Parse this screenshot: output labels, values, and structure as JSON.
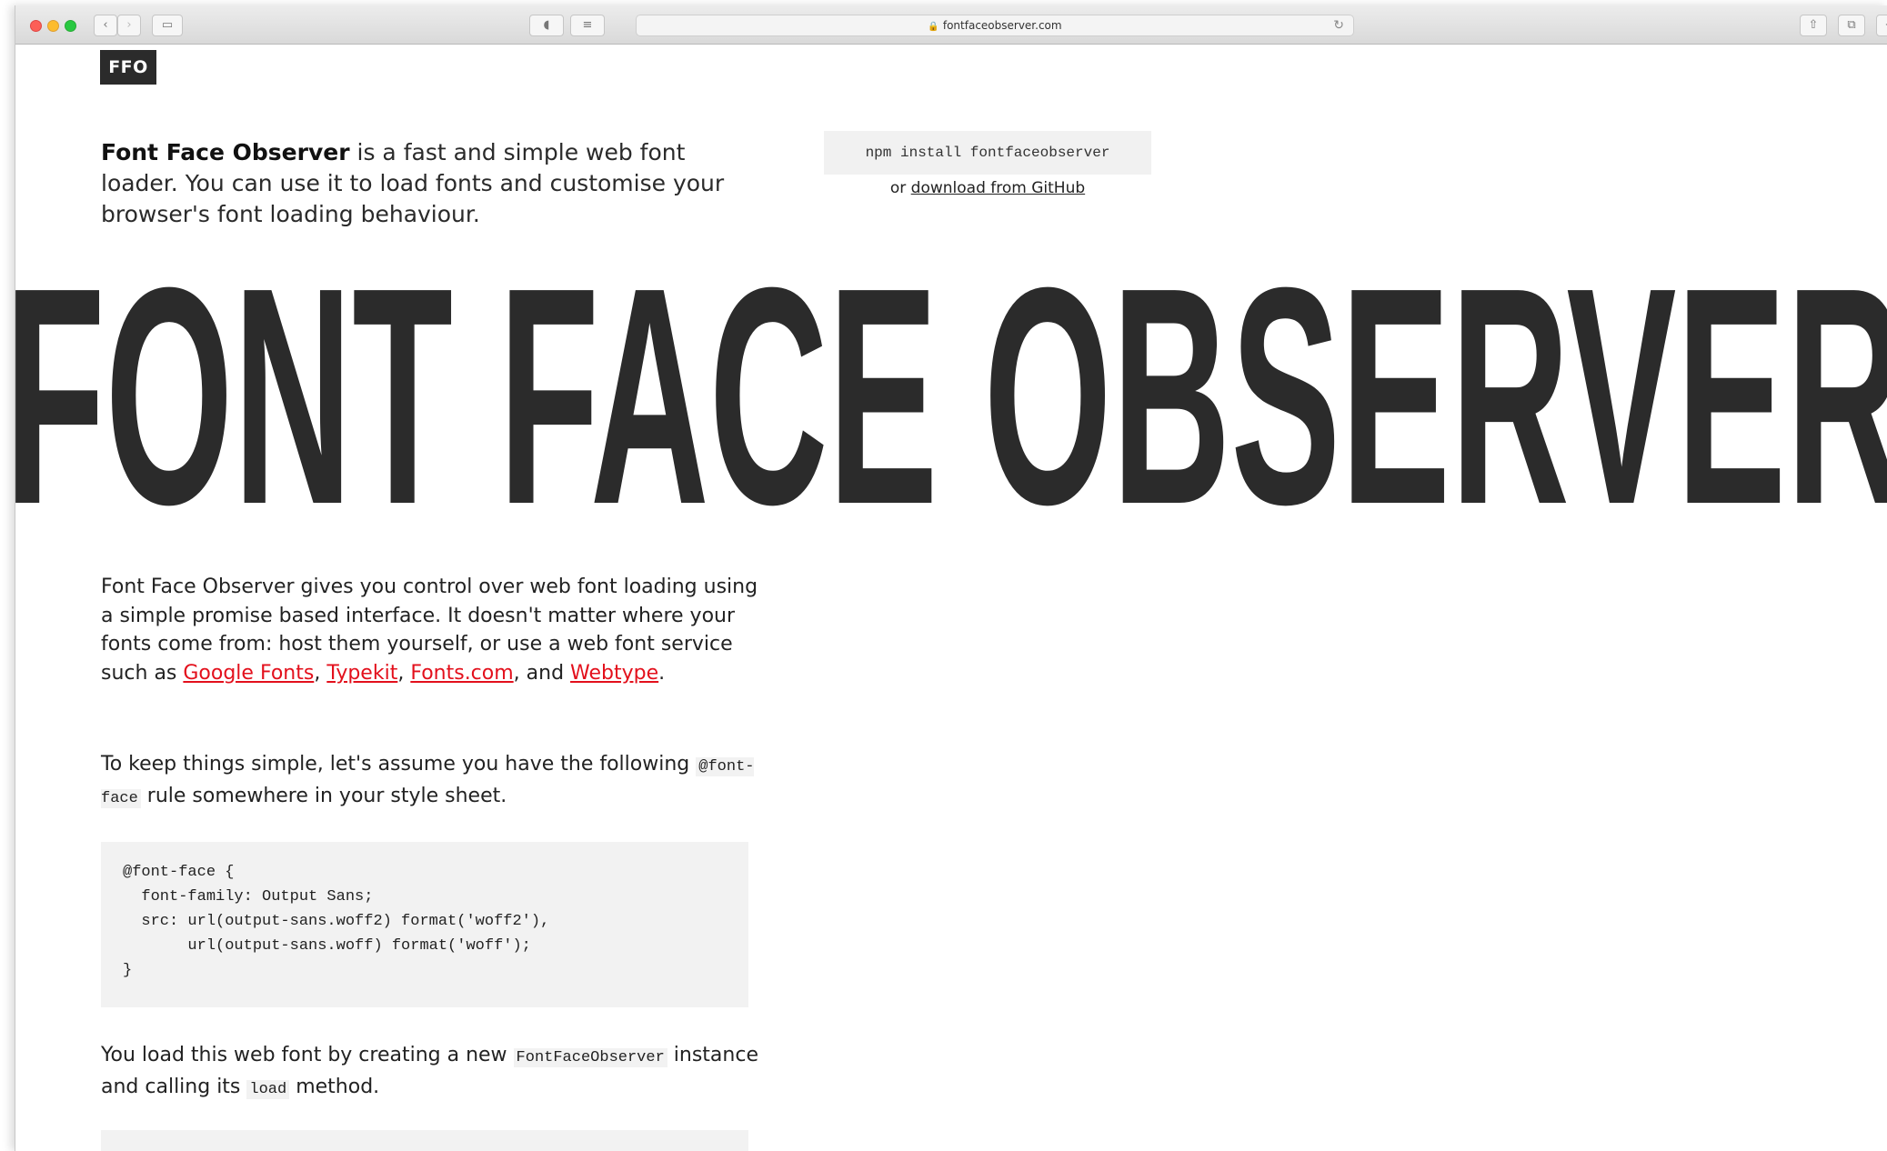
{
  "browser": {
    "url": "fontfaceobserver.com"
  },
  "logo": "FFO",
  "intro": {
    "bold": "Font Face Observer",
    "rest": " is a fast and simple web font loader. You can use it to load fonts and customise your browser's font loading behaviour."
  },
  "npm": "npm install fontfaceobserver",
  "download": {
    "prefix": "or ",
    "link": "download from GitHub"
  },
  "hero": "FONT FACE OBSERVER",
  "p1": {
    "text": "Font Face Observer gives you control over web font loading using a simple promise based interface. It doesn't matter where your fonts come from: host them yourself, or use a web font service such as ",
    "links": [
      "Google Fonts",
      "Typekit",
      "Fonts.com",
      "Webtype"
    ],
    "sep1": ", ",
    "sep2": ", ",
    "sep3": ", and ",
    "end": "."
  },
  "p2": {
    "before": "To keep things simple, let's assume you have the following ",
    "code": "@font-face",
    "after": " rule somewhere in your style sheet."
  },
  "code_block": "@font-face {\n  font-family: Output Sans;\n  src: url(output-sans.woff2) format('woff2'),\n       url(output-sans.woff) format('woff');\n}",
  "p3": {
    "before": "You load this web font by creating a new ",
    "code1": "FontFaceObserver",
    "middle": " instance and calling its ",
    "code2": "load",
    "after": " method."
  }
}
